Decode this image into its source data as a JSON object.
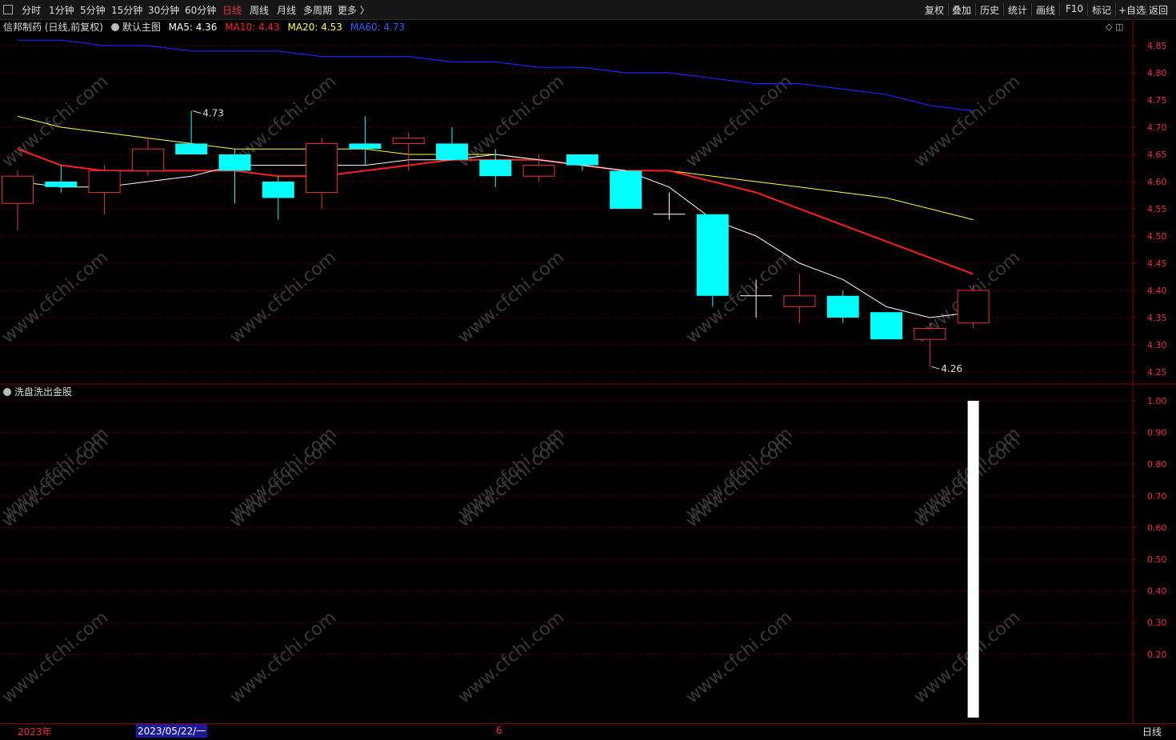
{
  "toolbar": {
    "periods": [
      "分时",
      "1分钟",
      "5分钟",
      "15分钟",
      "30分钟",
      "60分钟",
      "日线",
      "周线",
      "月线",
      "多周期",
      "更多 〉"
    ],
    "active_period": "日线",
    "actions": [
      "复权",
      "叠加",
      "历史",
      "统计",
      "画线",
      "F10",
      "标记",
      "+自选",
      "返回"
    ]
  },
  "main_legend": {
    "stock": "信邦制药 (日线,前复权)",
    "template": "默认主图",
    "ma5": "MA5: 4.36",
    "ma10": "MA10: 4.43",
    "ma20": "MA20: 4.53",
    "ma60": "MA60: 4.73"
  },
  "sub_legend": {
    "indicator": "洗盘洗出金股"
  },
  "bottom": {
    "year": "2023年",
    "cursor_date": "2023/05/22/一",
    "month_mark": "6",
    "period": "日线"
  },
  "colors": {
    "up": "#e8323a",
    "down": "#00ffff",
    "ma5": "#ffffff",
    "ma10": "#ff2020",
    "ma20": "#ffff40",
    "ma60": "#2020ff"
  },
  "chart_data": [
    {
      "type": "candlestick",
      "title": "信邦制药 (日线,前复权)",
      "y_ticks": [
        "4.85",
        "4.80",
        "4.75",
        "4.70",
        "4.65",
        "4.60",
        "4.55",
        "4.50",
        "4.45",
        "4.40",
        "4.35",
        "4.30",
        "4.25"
      ],
      "ylim": [
        4.23,
        4.88
      ],
      "candles": [
        {
          "o": 4.56,
          "h": 4.62,
          "l": 4.51,
          "c": 4.61
        },
        {
          "o": 4.6,
          "h": 4.63,
          "l": 4.58,
          "c": 4.59
        },
        {
          "o": 4.58,
          "h": 4.63,
          "l": 4.54,
          "c": 4.62
        },
        {
          "o": 4.62,
          "h": 4.68,
          "l": 4.61,
          "c": 4.66
        },
        {
          "o": 4.67,
          "h": 4.73,
          "l": 4.65,
          "c": 4.65
        },
        {
          "o": 4.65,
          "h": 4.66,
          "l": 4.56,
          "c": 4.62
        },
        {
          "o": 4.6,
          "h": 4.61,
          "l": 4.53,
          "c": 4.57
        },
        {
          "o": 4.58,
          "h": 4.68,
          "l": 4.55,
          "c": 4.67
        },
        {
          "o": 4.67,
          "h": 4.72,
          "l": 4.63,
          "c": 4.66
        },
        {
          "o": 4.67,
          "h": 4.69,
          "l": 4.62,
          "c": 4.68
        },
        {
          "o": 4.67,
          "h": 4.7,
          "l": 4.64,
          "c": 4.64
        },
        {
          "o": 4.64,
          "h": 4.66,
          "l": 4.59,
          "c": 4.61
        },
        {
          "o": 4.61,
          "h": 4.65,
          "l": 4.6,
          "c": 4.63
        },
        {
          "o": 4.65,
          "h": 4.65,
          "l": 4.62,
          "c": 4.63
        },
        {
          "o": 4.62,
          "h": 4.62,
          "l": 4.55,
          "c": 4.55
        },
        {
          "o": 4.54,
          "h": 4.58,
          "l": 4.53,
          "c": 4.54
        },
        {
          "o": 4.54,
          "h": 4.54,
          "l": 4.37,
          "c": 4.39
        },
        {
          "o": 4.39,
          "h": 4.42,
          "l": 4.35,
          "c": 4.39
        },
        {
          "o": 4.37,
          "h": 4.43,
          "l": 4.34,
          "c": 4.39
        },
        {
          "o": 4.39,
          "h": 4.4,
          "l": 4.34,
          "c": 4.35
        },
        {
          "o": 4.36,
          "h": 4.36,
          "l": 4.31,
          "c": 4.31
        },
        {
          "o": 4.31,
          "h": 4.34,
          "l": 4.26,
          "c": 4.33
        },
        {
          "o": 4.34,
          "h": 4.41,
          "l": 4.33,
          "c": 4.4
        }
      ],
      "ma5": [
        4.6,
        4.59,
        4.59,
        4.6,
        4.61,
        4.63,
        4.63,
        4.63,
        4.63,
        4.64,
        4.64,
        4.65,
        4.64,
        4.63,
        4.62,
        4.59,
        4.53,
        4.5,
        4.45,
        4.42,
        4.37,
        4.35,
        4.36
      ],
      "ma10": [
        4.66,
        4.63,
        4.62,
        4.62,
        4.62,
        4.62,
        4.61,
        4.61,
        4.62,
        4.63,
        4.64,
        4.64,
        4.64,
        4.63,
        4.62,
        4.62,
        4.6,
        4.58,
        4.55,
        4.52,
        4.49,
        4.46,
        4.43
      ],
      "ma20": [
        4.72,
        4.7,
        4.69,
        4.68,
        4.67,
        4.66,
        4.66,
        4.66,
        4.66,
        4.65,
        4.65,
        4.65,
        4.64,
        4.63,
        4.62,
        4.62,
        4.61,
        4.6,
        4.59,
        4.58,
        4.57,
        4.55,
        4.53
      ],
      "ma60": [
        4.86,
        4.86,
        4.85,
        4.85,
        4.84,
        4.84,
        4.84,
        4.83,
        4.83,
        4.83,
        4.82,
        4.82,
        4.81,
        4.81,
        4.8,
        4.8,
        4.79,
        4.78,
        4.78,
        4.77,
        4.76,
        4.74,
        4.73
      ],
      "annotations": [
        {
          "label": "4.73",
          "candle": 4,
          "value": 4.73
        },
        {
          "label": "4.26",
          "candle": 21,
          "value": 4.26
        }
      ]
    },
    {
      "type": "bar",
      "title": "洗盘洗出金股",
      "y_ticks": [
        "1.00",
        "0.90",
        "0.80",
        "0.70",
        "0.60",
        "0.50",
        "0.40",
        "0.30",
        "0.20"
      ],
      "ylim": [
        0.0,
        1.0
      ],
      "signal_candle": 22,
      "value": 1.0
    }
  ]
}
